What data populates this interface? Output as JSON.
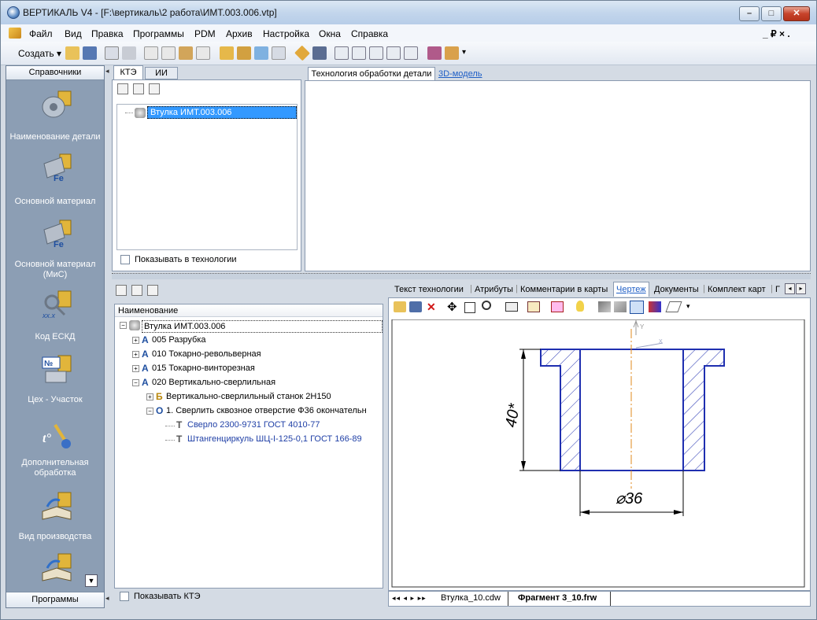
{
  "window": {
    "title": "ВЕРТИКАЛЬ V4 - [F:\\вертикаль\\2 работа\\ИМТ.003.006.vtp]"
  },
  "menu": [
    "Файл",
    "Вид",
    "Правка",
    "Программы",
    "PDM",
    "Архив",
    "Настройка",
    "Окна",
    "Справка"
  ],
  "menu_right": "_ ₽ × .",
  "toolbar": {
    "create_label": "Создать ▾"
  },
  "left_panel": {
    "header": "Справочники",
    "items": [
      "Наименование детали",
      "Основной материал",
      "Основной материал (МиС)",
      "Код ЕСКД",
      "Цех - Участок",
      "Дополнительная обработка",
      "Вид производства"
    ],
    "footer": "Программы",
    "icon_labels": {
      "fe1": "Fe",
      "fe2": "Fe",
      "code": "xx.x",
      "no": "№",
      "t": "t°"
    }
  },
  "top_tree": {
    "tabs": [
      "КТЭ",
      "ИИ"
    ],
    "root": "Втулка  ИМТ.003.006",
    "show_checkbox": "Показывать в технологии"
  },
  "top_right": {
    "tabs": [
      "Технология обработки детали",
      "3D-модель"
    ]
  },
  "bottom_tree": {
    "column": "Наименование",
    "rows": [
      {
        "text": "Втулка  ИМТ.003.006",
        "badge": ""
      },
      {
        "text": "005  Разрубка",
        "badge": "А"
      },
      {
        "text": "010  Токарно-револьверная",
        "badge": "А"
      },
      {
        "text": "015  Токарно-винторезная",
        "badge": "А"
      },
      {
        "text": "020  Вертикально-сверлильная",
        "badge": "А"
      },
      {
        "text": "Вертикально-сверлильный станок 2Н150",
        "badge": "Б"
      },
      {
        "text": "1.  Сверлить сквозное отверстие Ф36 окончательн",
        "badge": "О"
      },
      {
        "text": "Сверло  2300-9731  ГОСТ 4010-77",
        "badge": "Т"
      },
      {
        "text": "Штангенциркуль  ШЦ-I-125-0,1  ГОСТ 166-89",
        "badge": "Т"
      }
    ],
    "show_checkbox": "Показывать КТЭ"
  },
  "bottom_right": {
    "tabs": [
      "Текст технологии",
      "Атрибуты",
      "Комментарии в карты",
      "Чертеж",
      "Документы",
      "Комплект карт",
      "Г"
    ],
    "active_tab": "Чертеж",
    "drawing": {
      "dim_height": "40*",
      "dim_diameter": "⌀36",
      "axis_label": "Y",
      "axis_label2": "X"
    },
    "sheet_nav": "◂◂ ◂ ▸ ▸▸",
    "sheet_tabs": [
      "Втулка_10.cdw",
      "Фрагмент 3_10.frw"
    ],
    "scroll_left": "◂",
    "scroll_right": "▸"
  }
}
